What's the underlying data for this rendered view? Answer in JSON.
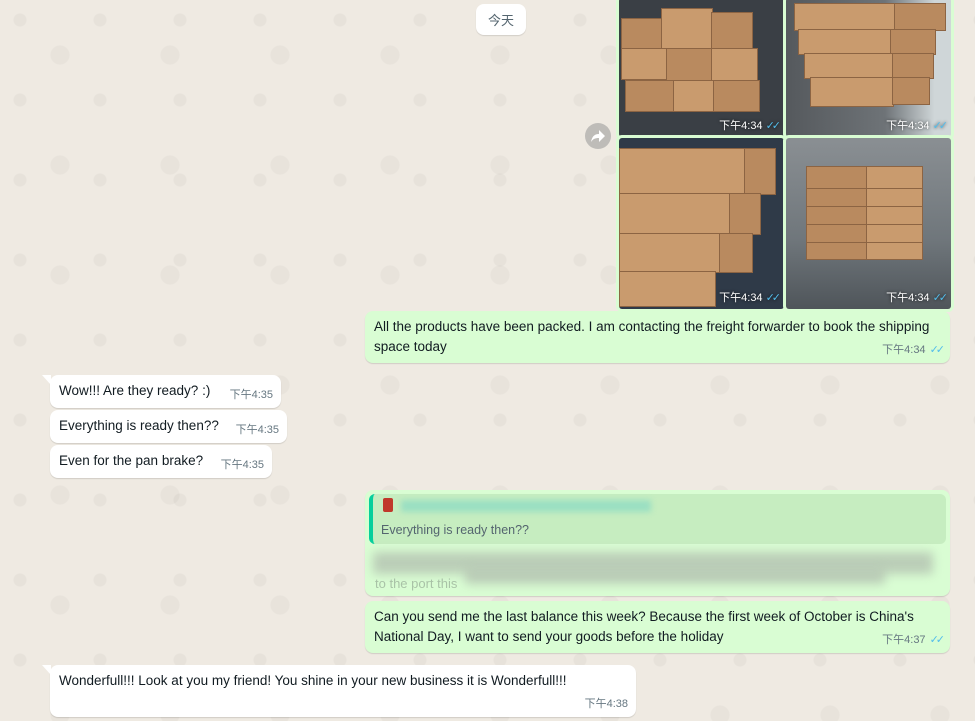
{
  "date_chip": "今天",
  "photos": [
    {
      "time": "下午4:34"
    },
    {
      "time": "下午4:34"
    },
    {
      "time": "下午4:34"
    },
    {
      "time": "下午4:34"
    }
  ],
  "messages": {
    "packed": {
      "text": "All the products have been packed. I am contacting the freight forwarder to book the shipping space today",
      "time": "下午4:34"
    },
    "wow": {
      "text": "Wow!!! Are they ready? :)",
      "time": "下午4:35"
    },
    "ready": {
      "text": "Everything is ready then??",
      "time": "下午4:35"
    },
    "pan": {
      "text": "Even for the pan brake?",
      "time": "下午4:35"
    },
    "reply": {
      "quoted": "Everything is ready then??",
      "partial": "to the port this"
    },
    "balance": {
      "text": "Can you send me the last balance this week? Because the first week of October is China's National Day, I want to send your goods before the holiday",
      "time": "下午4:37"
    },
    "wonderful": {
      "text": "Wonderfull!!! Look at you my friend! You shine in your new business it is Wonderfull!!!",
      "time": "下午4:38"
    }
  },
  "colors": {
    "outgoing": "#d9fdd3",
    "incoming": "#ffffff",
    "read_ticks": "#53bdeb"
  }
}
